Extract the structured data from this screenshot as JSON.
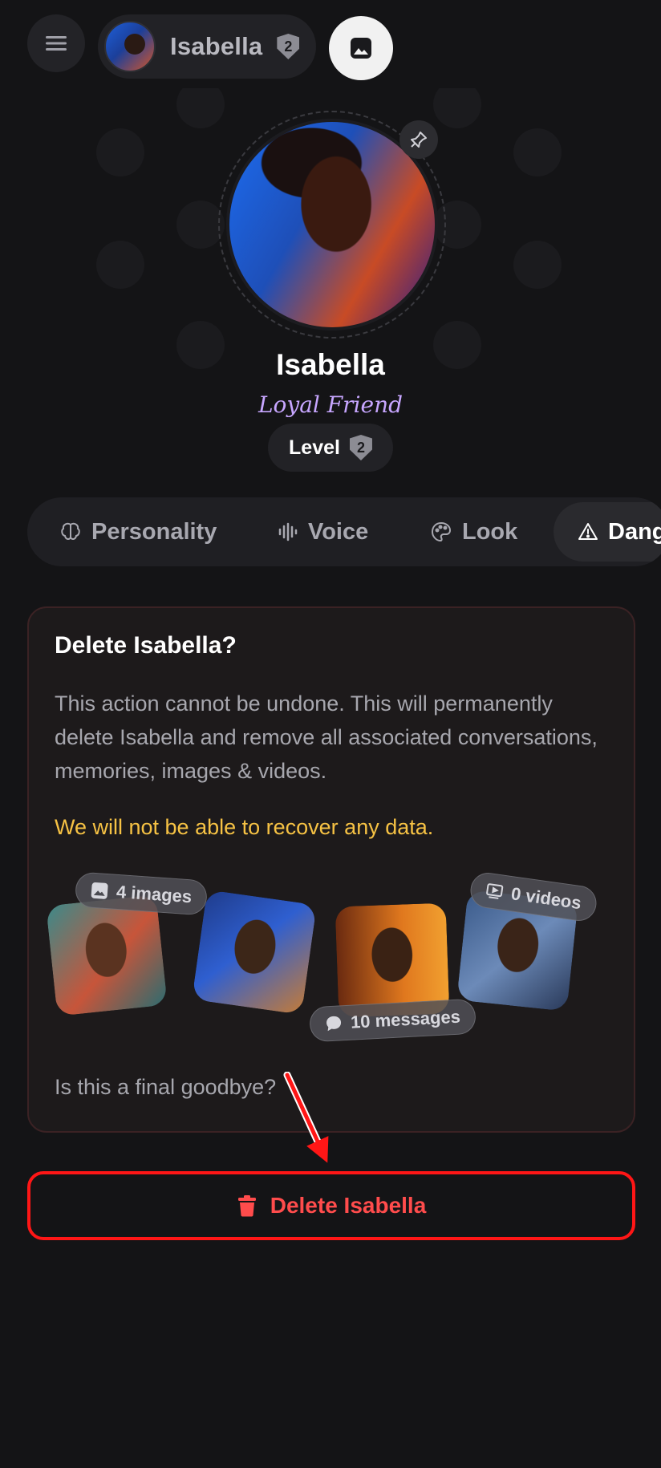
{
  "header": {
    "companion_name": "Isabella",
    "level_badge": "2"
  },
  "profile": {
    "name": "Isabella",
    "role": "Loyal Friend",
    "level_label": "Level",
    "level_value": "2"
  },
  "tabs": [
    {
      "label": "Personality",
      "icon": "brain-icon"
    },
    {
      "label": "Voice",
      "icon": "waveform-icon"
    },
    {
      "label": "Look",
      "icon": "palette-icon"
    },
    {
      "label": "Dang",
      "icon": "warning-icon"
    }
  ],
  "danger": {
    "title": "Delete Isabella?",
    "description": "This action cannot be undone. This will permanently delete Isabella and remove all associated conversations, memories, images & videos.",
    "warning": "We will not be able to recover any data.",
    "images_badge": "4 images",
    "videos_badge": "0 videos",
    "messages_badge": "10 messages",
    "question": "Is this a final goodbye?",
    "delete_label": "Delete Isabella"
  },
  "colors": {
    "background": "#141416",
    "accent_purple": "#c7a6ff",
    "warning_yellow": "#f6c244",
    "danger_red": "#ff4c4c",
    "highlight_red": "#ff1616"
  }
}
